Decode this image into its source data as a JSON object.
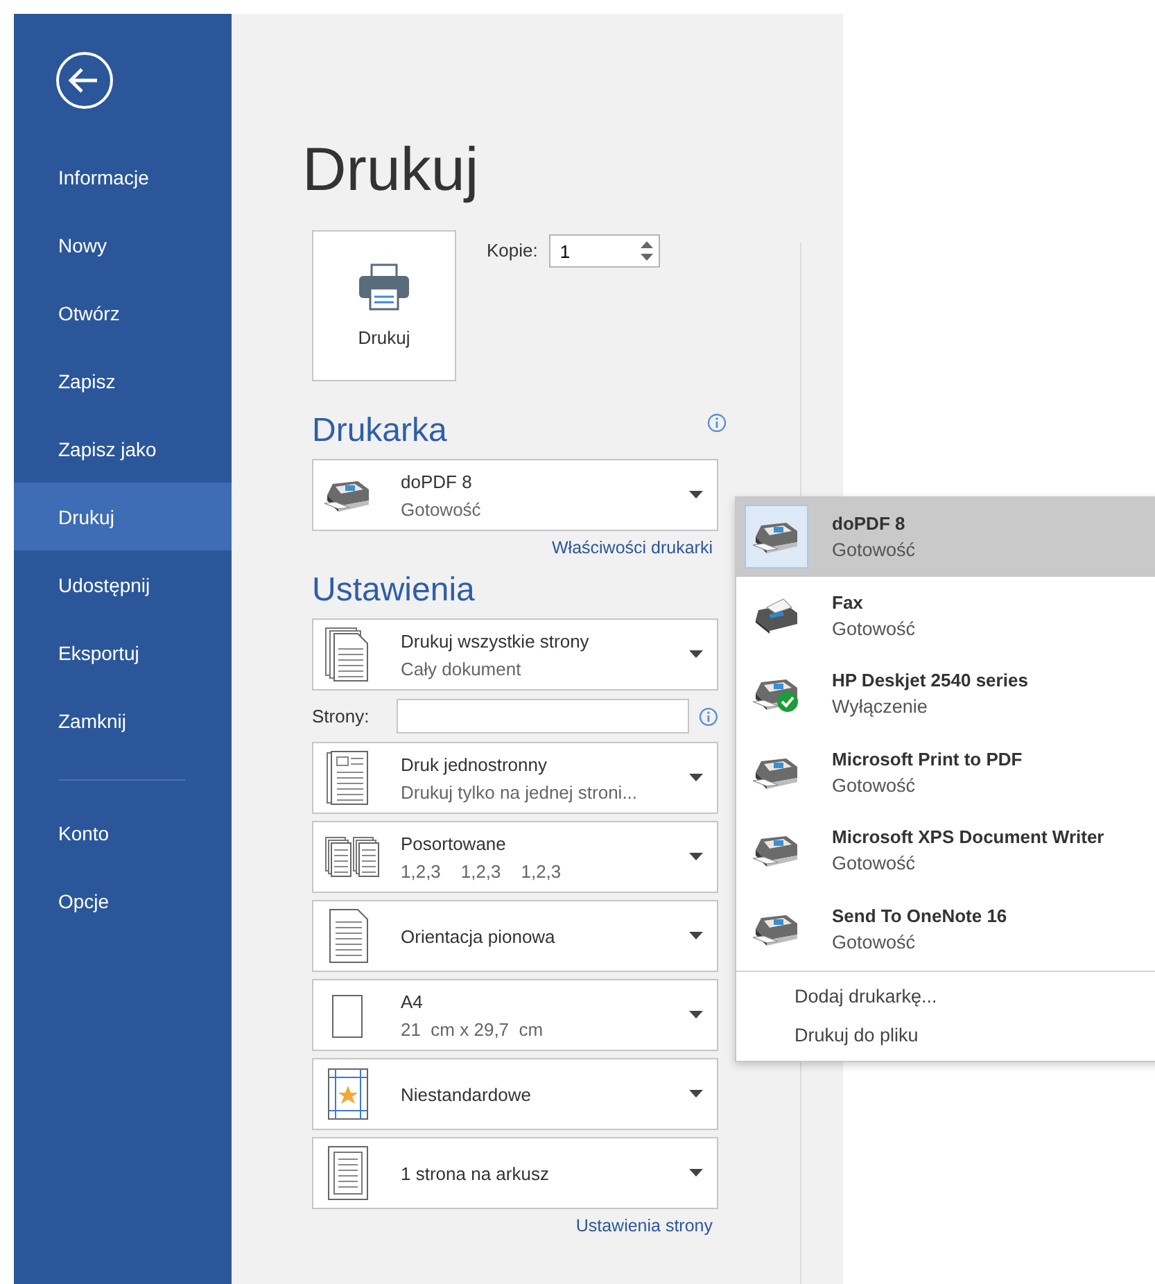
{
  "sidebar": {
    "items": [
      {
        "label": "Informacje",
        "selected": false
      },
      {
        "label": "Nowy",
        "selected": false
      },
      {
        "label": "Otwórz",
        "selected": false
      },
      {
        "label": "Zapisz",
        "selected": false
      },
      {
        "label": "Zapisz jako",
        "selected": false
      },
      {
        "label": "Drukuj",
        "selected": true
      },
      {
        "label": "Udostępnij",
        "selected": false
      },
      {
        "label": "Eksportuj",
        "selected": false
      },
      {
        "label": "Zamknij",
        "selected": false
      }
    ],
    "bottom_items": [
      {
        "label": "Konto",
        "selected": false
      },
      {
        "label": "Opcje",
        "selected": false
      }
    ]
  },
  "title": "Drukuj",
  "print_button": {
    "label": "Drukuj"
  },
  "copies": {
    "label": "Kopie:",
    "value": "1"
  },
  "printer_section": {
    "heading": "Drukarka",
    "printer": {
      "name": "doPDF 8",
      "status": "Gotowość"
    },
    "link": "Właściwości drukarki"
  },
  "settings_section": {
    "heading": "Ustawienia",
    "items": [
      {
        "kind": "pages",
        "title": "Drukuj wszystkie strony",
        "subtitle": "Cały dokument"
      },
      {
        "kind": "field",
        "label": "Strony:"
      },
      {
        "kind": "simplex",
        "title": "Druk jednostronny",
        "subtitle": "Drukuj tylko na jednej stroni..."
      },
      {
        "kind": "collate",
        "title": "Posortowane",
        "subtitle": "1,2,3    1,2,3    1,2,3"
      },
      {
        "kind": "orientation",
        "title": "Orientacja pionowa"
      },
      {
        "kind": "size",
        "title": "A4",
        "subtitle": "21  cm x 29,7  cm"
      },
      {
        "kind": "margins",
        "title": "Niestandardowe"
      },
      {
        "kind": "persheet",
        "title": "1 strona na arkusz"
      }
    ],
    "link": "Ustawienia strony"
  },
  "printer_menu": {
    "printers": [
      {
        "kind": "printer",
        "name": "doPDF 8",
        "status": "Gotowość",
        "selected": true,
        "default": false
      },
      {
        "kind": "fax",
        "name": "Fax",
        "status": "Gotowość",
        "selected": false,
        "default": false
      },
      {
        "kind": "printer",
        "name": "HP Deskjet 2540 series",
        "status": "Wyłączenie",
        "selected": false,
        "default": true
      },
      {
        "kind": "printer",
        "name": "Microsoft Print to PDF",
        "status": "Gotowość",
        "selected": false,
        "default": false
      },
      {
        "kind": "printer",
        "name": "Microsoft XPS Document Writer",
        "status": "Gotowość",
        "selected": false,
        "default": false
      },
      {
        "kind": "printer",
        "name": "Send To OneNote 16",
        "status": "Gotowość",
        "selected": false,
        "default": false
      }
    ],
    "actions": [
      "Dodaj drukarkę...",
      "Drukuj do pliku"
    ]
  }
}
